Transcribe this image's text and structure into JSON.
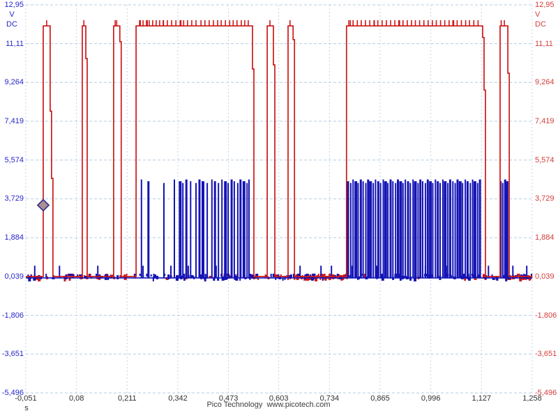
{
  "footer": {
    "text": "Pico Technology  www.picotech.com"
  },
  "chart_data": {
    "type": "line",
    "title": "",
    "x_unit": "s",
    "x_range": [
      -0.051,
      1.258
    ],
    "y_range": [
      -5.496,
      12.95
    ],
    "grid": true,
    "legend_position": "none",
    "x_tick_labels": [
      "-0,051",
      "0,08",
      "0,211",
      "0,342",
      "0,473",
      "0,603",
      "0,734",
      "0,865",
      "0,996",
      "1,127",
      "1,258"
    ],
    "x_tick_values": [
      -0.051,
      0.08,
      0.211,
      0.342,
      0.473,
      0.603,
      0.734,
      0.865,
      0.996,
      1.127,
      1.258
    ],
    "y_tick_labels": [
      "12,95",
      "11,11",
      "9,264",
      "7,419",
      "5,574",
      "3,729",
      "1,884",
      "0,039",
      "-1,806",
      "-3,651",
      "-5,496"
    ],
    "y_tick_values": [
      12.95,
      11.11,
      9.264,
      7.419,
      5.574,
      3.729,
      1.884,
      0.039,
      -1.806,
      -3.651,
      -5.496
    ],
    "y_axis_left": {
      "unit": "V",
      "coupling": "DC"
    },
    "y_axis_right": {
      "unit": "V",
      "coupling": "DC"
    },
    "colors": {
      "red_channel": "#cc1818",
      "blue_channel": "#1414b4",
      "left_axis_text": "#2626cc",
      "right_axis_text": "#d43c3c",
      "x_axis_text": "#303030",
      "footer_text": "#3c3c3c",
      "grid_row": "#b6ccdf",
      "grid_col": "#c2d6e6",
      "background": "#ffffff",
      "trigger_fill": "#ac8f94",
      "trigger_stroke": "#3a3a8c"
    },
    "trigger_marker": {
      "t": -0.006,
      "v": 3.43
    },
    "series": [
      {
        "name": "channel-red",
        "base_v": 0.039,
        "high_v": 11.95,
        "overshoot_v": 12.22,
        "pulses": [
          {
            "t0": -0.006,
            "t1": 0.012,
            "fall_steps": [
              7.9,
              4.7
            ]
          },
          {
            "t0": 0.095,
            "t1": 0.104,
            "fall_steps": [
              10.4
            ]
          },
          {
            "t0": 0.176,
            "t1": 0.192,
            "fall_steps": [
              11.2
            ]
          },
          {
            "t0": 0.234,
            "t1": 0.535,
            "fall_steps": [
              9.9
            ]
          },
          {
            "t0": 0.573,
            "t1": 0.589,
            "fall_steps": [
              10.1
            ]
          },
          {
            "t0": 0.627,
            "t1": 0.64,
            "fall_steps": [
              11.3
            ]
          },
          {
            "t0": 0.778,
            "t1": 1.13,
            "fall_steps": [
              11.4,
              8.9
            ]
          },
          {
            "t0": 1.175,
            "t1": 1.195,
            "fall_steps": [
              9.7
            ]
          }
        ],
        "top_ticks_t": [
          0.003,
          0.099,
          0.18,
          0.184,
          0.243,
          0.245,
          0.252,
          0.261,
          0.263,
          0.268,
          0.277,
          0.286,
          0.295,
          0.304,
          0.305,
          0.315,
          0.326,
          0.337,
          0.348,
          0.35,
          0.357,
          0.367,
          0.378,
          0.389,
          0.402,
          0.412,
          0.423,
          0.434,
          0.445,
          0.454,
          0.465,
          0.476,
          0.485,
          0.495,
          0.506,
          0.515,
          0.524,
          0.58,
          0.632,
          0.784,
          0.788,
          0.795,
          0.806,
          0.816,
          0.827,
          0.838,
          0.849,
          0.85,
          0.859,
          0.87,
          0.881,
          0.892,
          0.903,
          0.913,
          0.915,
          0.924,
          0.935,
          0.946,
          0.956,
          0.967,
          0.978,
          0.989,
          1.0,
          1.01,
          1.021,
          1.032,
          1.043,
          1.053,
          1.055,
          1.064,
          1.075,
          1.086,
          1.096,
          1.107,
          1.118,
          1.178,
          1.186
        ]
      },
      {
        "name": "channel-blue",
        "base_v": 0.039,
        "spike_v": 4.65,
        "spike_w_pattern": [
          2,
          3,
          2,
          2,
          4,
          2,
          3,
          2,
          2,
          3,
          4,
          2
        ],
        "spikes_t": [
          0.248,
          0.266,
          0.306,
          0.333,
          0.348,
          0.355,
          0.364,
          0.375,
          0.389,
          0.398,
          0.407,
          0.418,
          0.43,
          0.438,
          0.447,
          0.456,
          0.465,
          0.472,
          0.481,
          0.488,
          0.497,
          0.504,
          0.513,
          0.521,
          0.526,
          0.782,
          0.789,
          0.795,
          0.802,
          0.808,
          0.815,
          0.821,
          0.828,
          0.834,
          0.84,
          0.847,
          0.853,
          0.86,
          0.866,
          0.873,
          0.879,
          0.885,
          0.892,
          0.898,
          0.905,
          0.911,
          0.918,
          0.924,
          0.93,
          0.937,
          0.943,
          0.95,
          0.956,
          0.963,
          0.969,
          0.975,
          0.982,
          0.988,
          0.995,
          1.001,
          1.008,
          1.014,
          1.02,
          1.027,
          1.033,
          1.04,
          1.046,
          1.053,
          1.059,
          1.065,
          1.072,
          1.078,
          1.085,
          1.091,
          1.098,
          1.104,
          1.11,
          1.117,
          1.123,
          1.177,
          1.182,
          1.188,
          1.193
        ],
        "short_spike_v": 0.55,
        "short_spikes_t": [
          -0.028,
          0.036,
          0.135,
          0.252,
          0.324,
          0.369,
          0.441,
          0.513,
          0.658,
          0.712,
          0.739,
          0.793,
          0.856,
          0.91,
          0.982,
          1.036,
          1.072,
          1.145,
          1.208,
          1.244
        ]
      }
    ],
    "noise": {
      "baseline_v": 0.039,
      "blue_bands": [
        {
          "t0": -0.049,
          "t1": 1.256,
          "count": 170,
          "seed": 7
        }
      ],
      "red_bands": [
        {
          "t0": -0.049,
          "t1": 0.235,
          "count": 34,
          "seed": 11
        },
        {
          "t0": 0.29,
          "t1": 0.52,
          "count": 8,
          "seed": 13
        },
        {
          "t0": 0.52,
          "t1": 0.64,
          "count": 12,
          "seed": 17
        },
        {
          "t0": 0.64,
          "t1": 0.778,
          "count": 60,
          "seed": 19
        },
        {
          "t0": 0.78,
          "t1": 1.13,
          "count": 6,
          "seed": 23
        },
        {
          "t0": 1.13,
          "t1": 1.195,
          "count": 6,
          "seed": 29
        },
        {
          "t0": 1.195,
          "t1": 1.256,
          "count": 24,
          "seed": 31
        }
      ]
    }
  }
}
